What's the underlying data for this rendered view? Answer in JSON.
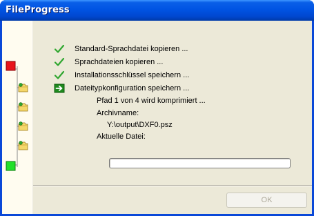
{
  "window": {
    "title": "FileProgress"
  },
  "steps": [
    {
      "label": "Standard-Sprachdatei kopieren ...",
      "status": "done",
      "icon": "checkmark-icon"
    },
    {
      "label": "Sprachdateien kopieren ...",
      "status": "done",
      "icon": "checkmark-icon"
    },
    {
      "label": "Installationsschlüssel speichern ...",
      "status": "done",
      "icon": "checkmark-icon"
    },
    {
      "label": "Dateitypkonfiguration speichern ...",
      "status": "current",
      "icon": "arrow-right-icon"
    }
  ],
  "details": {
    "path_status": "Pfad 1 von 4 wird komprimiert ...",
    "archive_label": "Archivname:",
    "archive_value": "Y:\\output\\DXF0.psz",
    "current_file_label": "Aktuelle Datei:",
    "current_file_value": ""
  },
  "progress": {
    "value": 0.0
  },
  "buttons": {
    "ok_label": "OK",
    "ok_enabled": false
  },
  "sidebar": {
    "start_color": "#e8141c",
    "end_color": "#22e02a",
    "folder_count": 4
  },
  "colors": {
    "titlebar": "#0054e3",
    "dialog_bg": "#ece9d8",
    "check_green": "#2fa62f",
    "arrow_green": "#1e8a1e"
  }
}
